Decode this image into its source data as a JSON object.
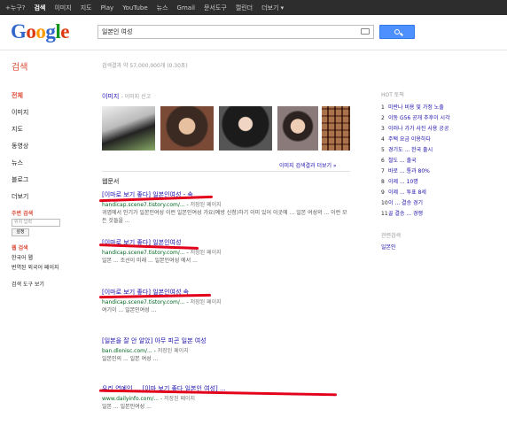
{
  "topbar": {
    "items": [
      {
        "label": "+누구?",
        "active": false
      },
      {
        "label": "검색",
        "active": true
      },
      {
        "label": "이미지",
        "active": false
      },
      {
        "label": "지도",
        "active": false
      },
      {
        "label": "Play",
        "active": false
      },
      {
        "label": "YouTube",
        "active": false
      },
      {
        "label": "뉴스",
        "active": false
      },
      {
        "label": "Gmail",
        "active": false
      },
      {
        "label": "문서도구",
        "active": false
      },
      {
        "label": "캘린더",
        "active": false
      },
      {
        "label": "더보기 ▾",
        "active": false
      }
    ]
  },
  "logo": {
    "letters": [
      "G",
      "o",
      "o",
      "g",
      "l",
      "e"
    ],
    "colors": [
      "#3366cc",
      "#dc3912",
      "#ff9900",
      "#3366cc",
      "#109618",
      "#dc3912"
    ]
  },
  "search": {
    "query": "일본인 여성"
  },
  "search_label": "검색",
  "result_stats": "검색결과 약 57,000,000개 (0.30초)",
  "sidebar": {
    "items": [
      {
        "label": "전체",
        "active": true
      },
      {
        "label": "이미지",
        "active": false
      },
      {
        "label": "지도",
        "active": false
      },
      {
        "label": "동영상",
        "active": false
      },
      {
        "label": "뉴스",
        "active": false
      },
      {
        "label": "블로그",
        "active": false
      },
      {
        "label": "더보기",
        "active": false
      }
    ],
    "location_title": "주변 검색",
    "location_placeholder": "위치 입력",
    "location_button": "설정",
    "lang_title": "웹 검색",
    "lang_items": [
      "한국어 웹",
      "번역된 외국어 페이지"
    ],
    "tools": "검색 도구 보기"
  },
  "images_section": {
    "title": "이미지",
    "subtitle": "- 이미지 신고",
    "more": "이미지 검색결과 더보기 »"
  },
  "web_label": "웹문서",
  "results": [
    {
      "title": "[이마로 보기 좋다] 일본인여성 - 속",
      "url": "handicap.scene7.tistory.com/...",
      "cache": "저장된 페이지",
      "snippet": "귀엽에서 인기가 일본인여성 이런 일본인여성 가요(예방 신청)하기 이미 있어 이곳에 ... 일본 여성의 ... 이런 모든 것들을 ..."
    },
    {
      "title": "[이마로 보기 좋다] 일본인여성",
      "url": "handicap.scene7.tistory.com/...",
      "cache": "저장된 페이지",
      "snippet": "일본 ... 조선이 미래 ... 일본인여성 에서 ..."
    },
    {
      "title": "[이마로 보기 좋다] 일본인여성 속",
      "url": "handicap.scene7.tistory.com/...",
      "cache": "저장된 페이지",
      "snippet": "여기이 ... 일본인여성 ..."
    },
    {
      "title": "[일본을 잘 안 알았] 아무 피곤 일본 여성",
      "url": "ban.dlonisc.com/...",
      "cache": "저장된 페이지",
      "snippet": "일본인의 ... 일본 여성 ..."
    },
    {
      "title": "우리 연예인 ... [이마 보기 좋다 일본인 여성] ...",
      "url": "www.dailyinfo.com/...",
      "cache": "저장된 페이지",
      "snippet": "일본 ... 일본인여성 ..."
    }
  ],
  "hot_topics": {
    "title": "HOT 토픽",
    "items": [
      "미란나 비용 및 가정 노출",
      "이동 G56 공개 추후이 시각",
      "이러나 가가 사진 사용 공공",
      "주택 요금 이용하다",
      "경기도 ... 한국 출시",
      "철도 ... 출국",
      "바로 ... 통과 80%",
      "이제 ... 10명",
      "이제 ... 투표 8세",
      "이 ... 결승 경기",
      "골 결승 ... 경쟁"
    ]
  },
  "related": {
    "title": "관련검색",
    "items": [
      "일본인"
    ]
  },
  "colors": {
    "link": "#1a0dab",
    "url": "#006621",
    "accent": "#dd4b39",
    "mark": "#e3001b"
  }
}
